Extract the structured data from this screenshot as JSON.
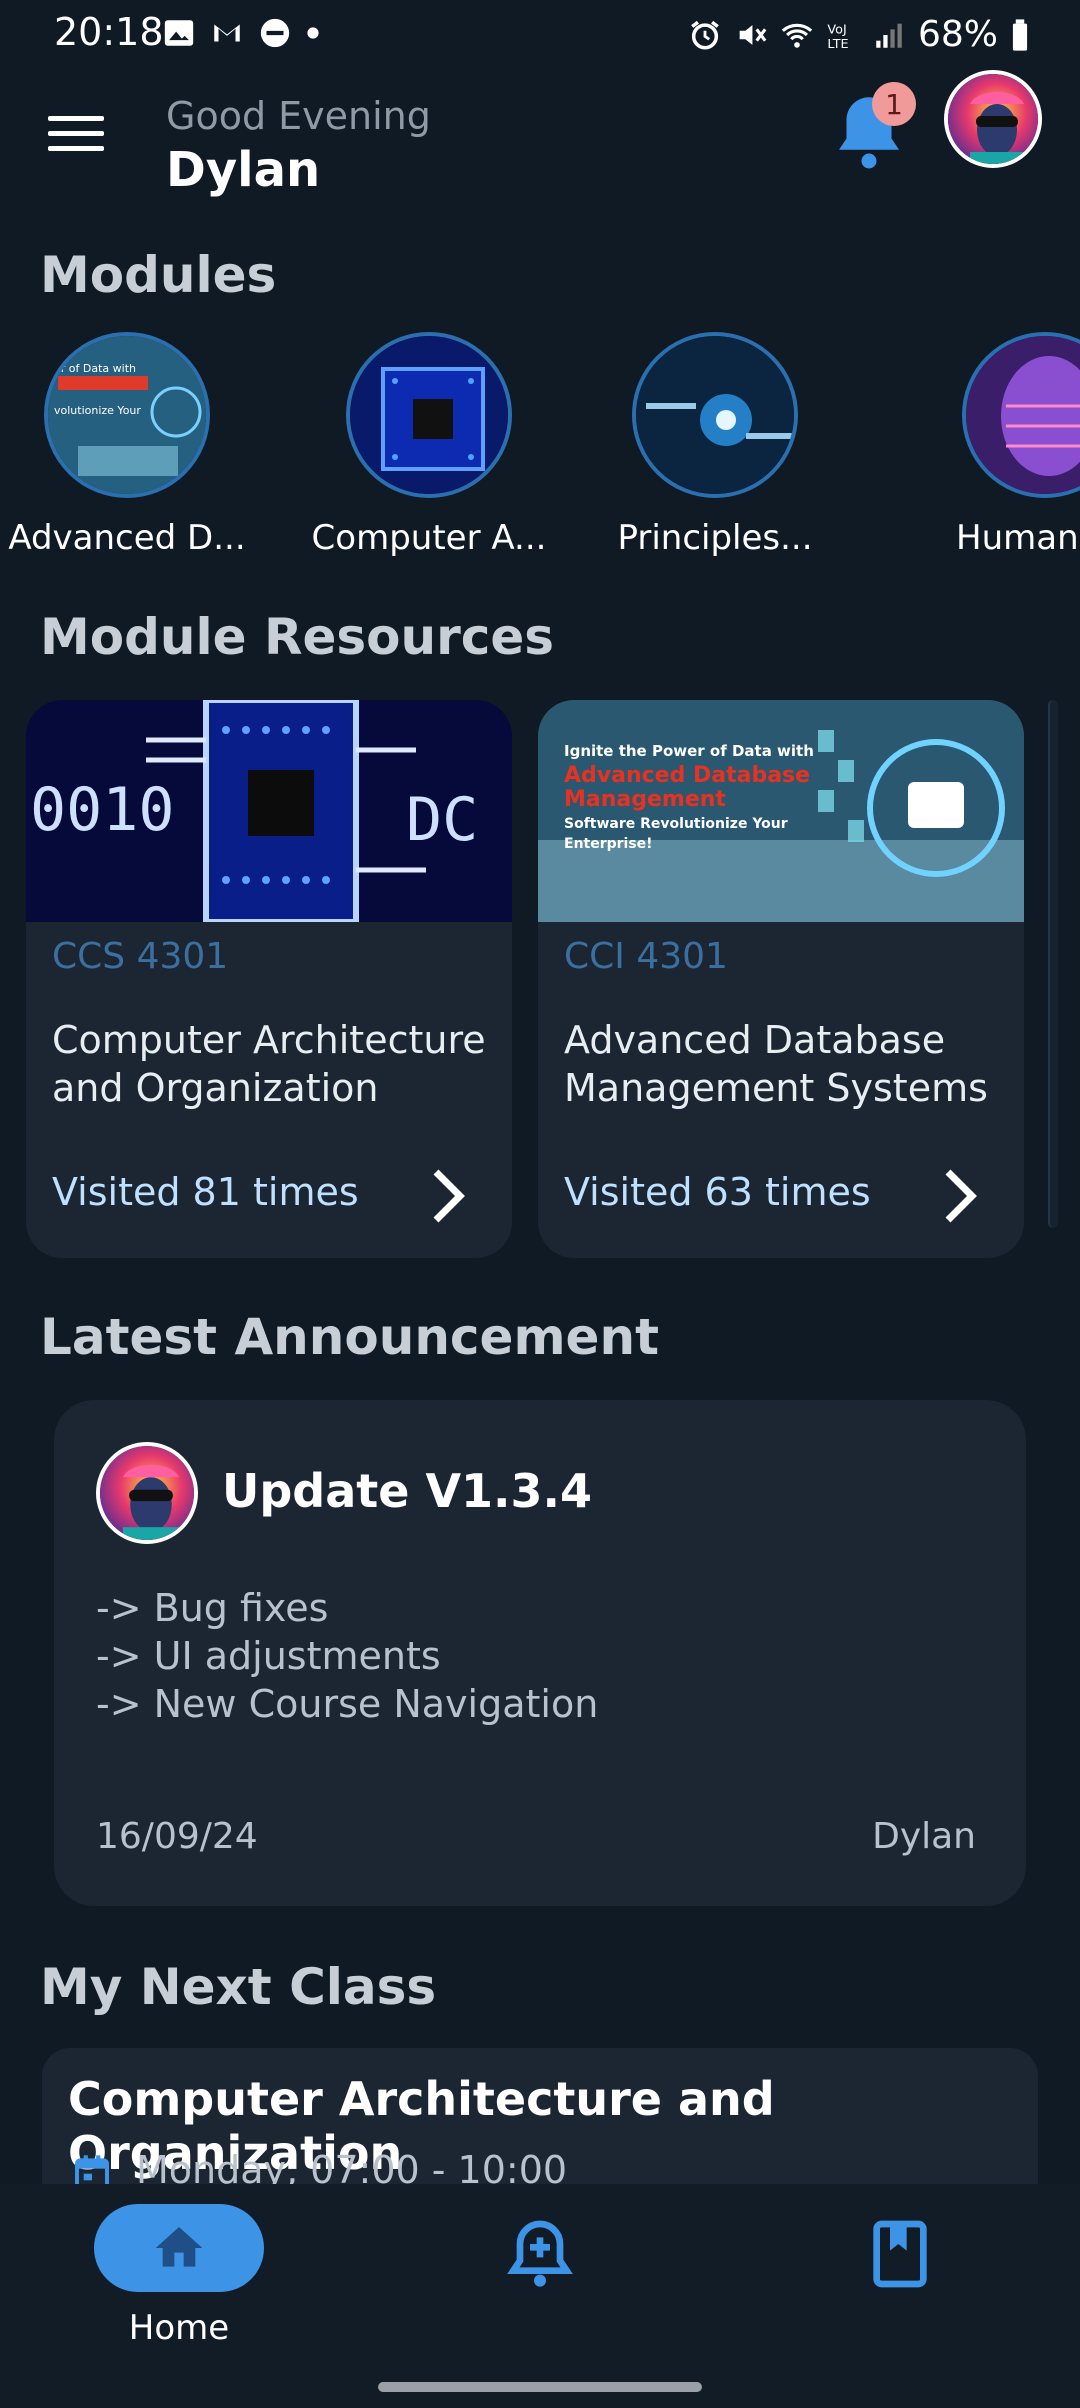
{
  "status_bar": {
    "time": "20:18",
    "battery": "68%",
    "left_icons": [
      "gallery-icon",
      "gmail-icon",
      "dnd-icon",
      "dot-icon"
    ],
    "right_icons": [
      "alarm-icon",
      "mute-icon",
      "wifi-icon",
      "volte-icon",
      "signal-icon",
      "battery-icon"
    ]
  },
  "header": {
    "greeting": "Good Evening",
    "user_name": "Dylan",
    "notification_count": "1"
  },
  "modules": {
    "title": "Modules",
    "items": [
      {
        "label": "Advanced D..."
      },
      {
        "label": "Computer A..."
      },
      {
        "label": "Principles..."
      },
      {
        "label": "Human Co"
      }
    ]
  },
  "resources": {
    "title": "Module Resources",
    "cards": [
      {
        "code": "CCS 4301",
        "title": "Computer Architecture and Organization",
        "visits": "Visited 81 times"
      },
      {
        "code": "CCI 4301",
        "title": "Advanced Database Management Systems",
        "visits": "Visited 63 times",
        "thumb_text": [
          "Ignite the Power of Data with",
          "Advanced Database",
          "Management",
          "Software Revolutionize Your",
          "Enterprise!"
        ]
      }
    ]
  },
  "announcement": {
    "section_title": "Latest Announcement",
    "title": "Update V1.3.4",
    "lines": [
      "-> Bug fixes",
      "-> UI adjustments",
      "-> New Course Navigation"
    ],
    "date": "16/09/24",
    "author": "Dylan"
  },
  "next_class": {
    "section_title": "My Next Class",
    "course": "Computer Architecture and Organization",
    "schedule": "Monday, 07:00 - 10:00"
  },
  "bottom_nav": {
    "home_label": "Home",
    "items": [
      "home-icon",
      "announcement-icon",
      "book-icon"
    ]
  },
  "colors": {
    "background": "#101a24",
    "card": "#1b2632",
    "accent": "#3d94e6",
    "course_code": "#3b6f9f",
    "badge": "#f19a9a"
  }
}
